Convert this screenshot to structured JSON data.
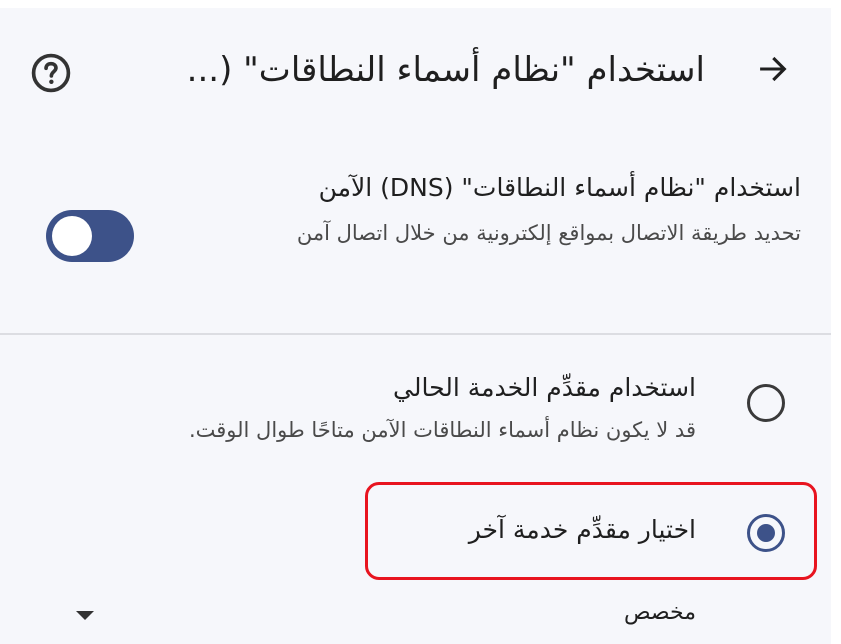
{
  "header": {
    "title": "استخدام \"نظام أسماء النطاقات\" (...",
    "back_icon": "arrow-right-icon",
    "help_icon": "help-circle-icon"
  },
  "secure_dns": {
    "title": "استخدام \"نظام أسماء النطاقات\" (DNS) الآمن",
    "description": "تحديد طريقة الاتصال بمواقع إلكترونية من خلال اتصال آمن",
    "toggle_on": false
  },
  "options": {
    "current_provider": {
      "title": "استخدام مقدِّم الخدمة الحالي",
      "description": "قد لا يكون نظام أسماء النطاقات الآمن متاحًا طوال الوقت.",
      "selected": false
    },
    "custom_provider": {
      "title": "اختيار مقدِّم خدمة آخر",
      "selected": true
    }
  },
  "dropdown": {
    "selected": "مخصص"
  },
  "colors": {
    "accent": "#3d5289",
    "highlight": "#e8141f",
    "background": "#f6f7fb"
  }
}
